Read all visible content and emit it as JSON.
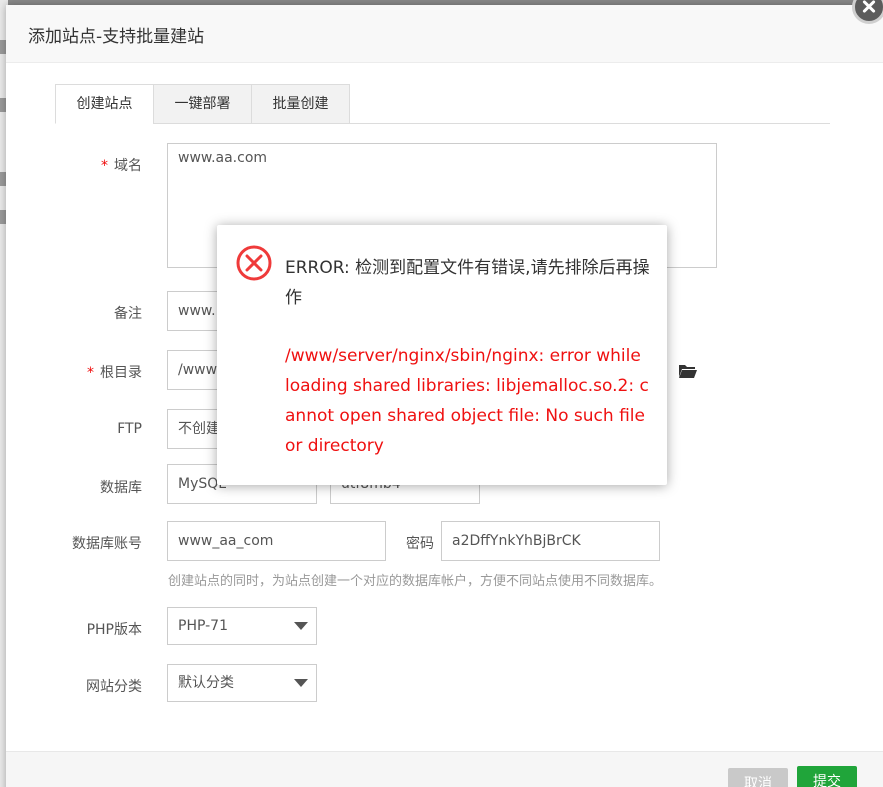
{
  "dialog": {
    "title": "添加站点-支持批量建站"
  },
  "tabs": [
    {
      "label": "创建站点",
      "active": true
    },
    {
      "label": "一键部署",
      "active": false
    },
    {
      "label": "批量创建",
      "active": false
    }
  ],
  "form": {
    "domain": {
      "label": "域名",
      "required_mark": "*",
      "value": "www.aa.com"
    },
    "note": {
      "label": "备注",
      "value": "www."
    },
    "root": {
      "label": "根目录",
      "required_mark": "*",
      "value": "/www"
    },
    "ftp": {
      "label": "FTP",
      "value": "不创建"
    },
    "database": {
      "label": "数据库",
      "type_value": "MySQL",
      "charset_value": "utf8mb4"
    },
    "db_account": {
      "label": "数据库账号",
      "value": "www_aa_com",
      "password_label": "密码",
      "password_value": "a2DffYnkYhBjBrCK"
    },
    "db_hint": "创建站点的同时，为站点创建一个对应的数据库帐户，方便不同站点使用不同数据库。",
    "php": {
      "label": "PHP版本",
      "value": "PHP-71"
    },
    "category": {
      "label": "网站分类",
      "value": "默认分类"
    }
  },
  "footer": {
    "cancel_label": "取消",
    "submit_label": "提交"
  },
  "error_modal": {
    "title": "ERROR: 检测到配置文件有错误,请先排除后再操作",
    "detail": "/www/server/nginx/sbin/nginx: error while loading shared libraries: libjemalloc.so.2: cannot open shared object file: No such file or directory",
    "icon": "error-circle-icon"
  },
  "colors": {
    "error_red": "#ef1010",
    "submit_green": "#20a53a",
    "cancel_gray": "#c9c9c9"
  }
}
